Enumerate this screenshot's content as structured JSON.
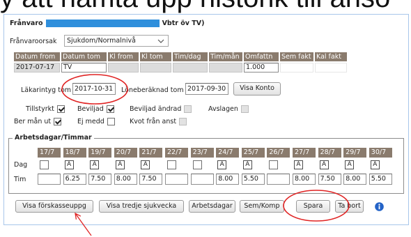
{
  "doc_heading": "y att hämta upp historik till ansö",
  "panel": {
    "title_prefix": "Frånvaro",
    "title_suffix": "Vbtr öv TV)"
  },
  "reason": {
    "label": "Frånvaroorsak",
    "value": "Sjukdom/Normalnivå"
  },
  "period_table": {
    "headers": [
      "Datum from",
      "Datum tom",
      "Kl from",
      "Kl tom",
      "Tim/dag",
      "Tim/mån",
      "Omfattn",
      "Sem fakt",
      "Kal fakt"
    ],
    "row": [
      "2017-07-17",
      "TV",
      "",
      "",
      "",
      "",
      "1.000",
      "",
      ""
    ]
  },
  "certificate": {
    "label": "Läkarintyg tom",
    "value": "2017-10-31"
  },
  "payroll": {
    "label": "Löneberäknad tom",
    "value": "2017-09-30"
  },
  "show_account_button": "Visa Konto",
  "checkboxes": [
    {
      "label": "Tillstyrkt",
      "checked": true,
      "disabled": false
    },
    {
      "label": "Beviljad",
      "checked": true,
      "disabled": false
    },
    {
      "label": "Beviljad ändrad",
      "checked": false,
      "disabled": true
    },
    {
      "label": "Avslagen",
      "checked": false,
      "disabled": true
    },
    {
      "label": "Ber mån ut",
      "checked": true,
      "disabled": false
    },
    {
      "label": "Ej medd",
      "checked": false,
      "disabled": false
    },
    {
      "label": "Kvot från anst",
      "checked": false,
      "disabled": true
    }
  ],
  "workdays": {
    "legend": "Arbetsdagar/Timmar",
    "day_label": "Dag",
    "hours_label": "Tim",
    "dates": [
      "17/7",
      "18/7",
      "19/7",
      "20/7",
      "21/7",
      "22/7",
      "23/7",
      "24/7",
      "25/7",
      "26/7",
      "27/7",
      "28/7",
      "29/7",
      "30/7"
    ],
    "day_codes": [
      "",
      "A",
      "A",
      "A",
      "A",
      "",
      "",
      "A",
      "A",
      "",
      "A",
      "A",
      "A",
      "A"
    ],
    "hours": [
      "",
      "6.25",
      "7.50",
      "8.00",
      "7.50",
      "",
      "",
      "8.00",
      "5.50",
      "",
      "8.00",
      "7.50",
      "8.00",
      "5.50"
    ]
  },
  "buttons": {
    "show_insurance": "Visa förskasseuppg",
    "show_third_sick_week": "Visa tredje sjukvecka",
    "workdays": "Arbetsdagar",
    "vacation_comp": "Sem/Komp",
    "save": "Spara",
    "delete": "Ta bort"
  },
  "icons": {
    "reason_dropdown": "chevron-down-icon",
    "info": "info-icon"
  },
  "colors": {
    "header_bg": "#8a7b6d",
    "redaction": "#2f8fdc",
    "annotation": "#e02424",
    "info": "#2463c7",
    "panel_border": "#a8c6ea"
  }
}
